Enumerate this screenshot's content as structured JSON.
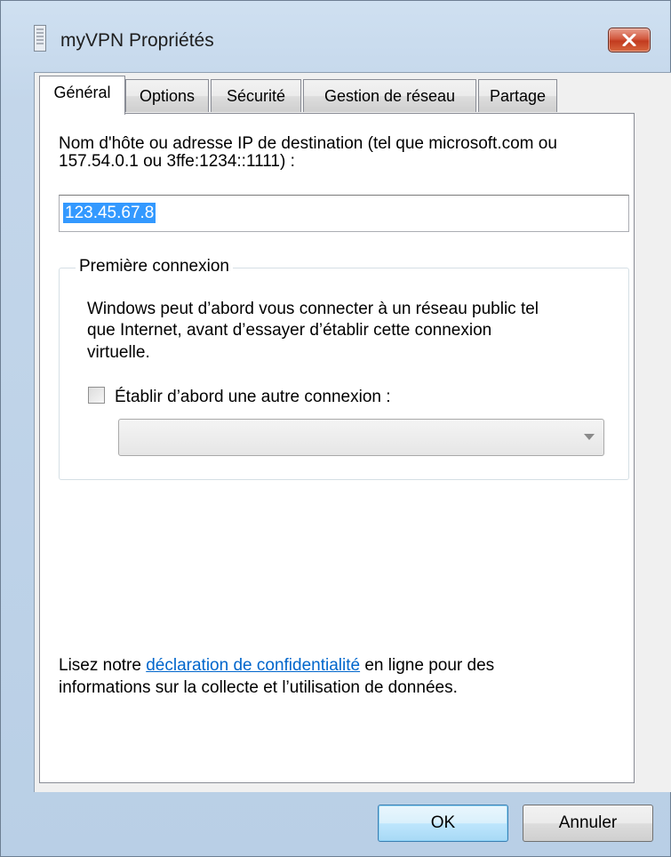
{
  "window": {
    "title": "myVPN Propriétés",
    "close_label": "✕"
  },
  "tabs": [
    {
      "label": "Général",
      "active": true
    },
    {
      "label": "Options",
      "active": false
    },
    {
      "label": "Sécurité",
      "active": false
    },
    {
      "label": "Gestion de réseau",
      "active": false
    },
    {
      "label": "Partage",
      "active": false
    }
  ],
  "general": {
    "dest_label_line1": "Nom d'hôte ou adresse IP de destination (tel que microsoft.com ou",
    "dest_label_line2": "157.54.0.1 ou 3ffe:1234::1111) :",
    "dest_value": "123.45.67.8",
    "group_title": "Première connexion",
    "group_text_line1": "Windows peut d’abord vous connecter à un réseau public tel",
    "group_text_line2": "que Internet, avant d’essayer d’établir cette connexion",
    "group_text_line3": "virtuelle.",
    "checkbox_label": "Établir d’abord une autre connexion :",
    "checkbox_checked": false,
    "dropdown_value": "",
    "privacy_prefix": "Lisez notre ",
    "privacy_link": "déclaration de confidentialité",
    "privacy_suffix": " en ligne pour des",
    "privacy_line2": "informations sur la collecte et l’utilisation de données."
  },
  "buttons": {
    "ok": "OK",
    "cancel": "Annuler"
  },
  "colors": {
    "link": "#0066cc",
    "selection": "#3399ff",
    "close_button": "#c23b1f"
  }
}
